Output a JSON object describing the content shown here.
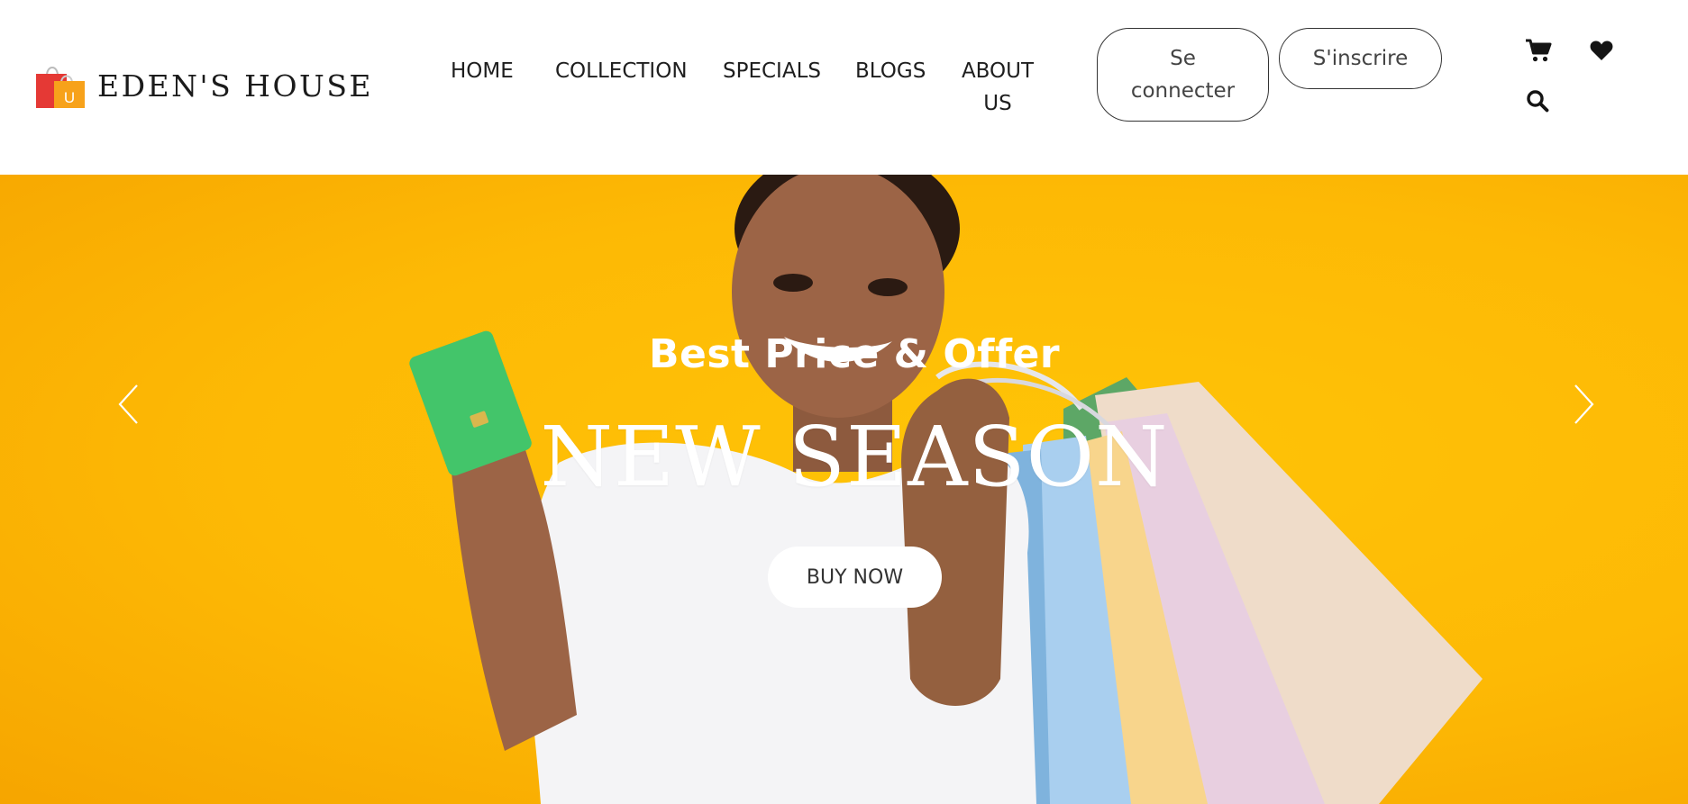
{
  "brand": {
    "name": "EDEN'S HOUSE",
    "logo_icon": "shopping-bags-logo",
    "logo_letter": "U"
  },
  "nav": [
    {
      "label": "HOME"
    },
    {
      "label": "COLLECTION"
    },
    {
      "label": "SPECIALS"
    },
    {
      "label": "BLOGS"
    },
    {
      "label": "ABOUT US"
    }
  ],
  "auth": {
    "login_label": "Se connecter",
    "register_label": "S'inscrire"
  },
  "icons": {
    "cart": "cart-icon",
    "wishlist": "heart-icon",
    "search": "search-icon"
  },
  "hero": {
    "subtitle": "Best Price & Offer",
    "title": "NEW SEASON",
    "cta_label": "BUY NOW",
    "prev_icon": "chevron-left-icon",
    "next_icon": "chevron-right-icon",
    "background_color": "#fdb905"
  }
}
